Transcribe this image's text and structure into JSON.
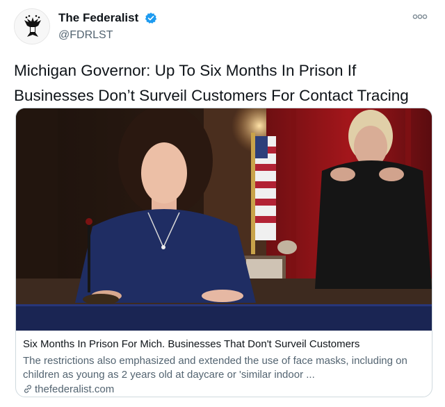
{
  "tweet": {
    "account": {
      "display_name": "The Federalist",
      "handle": "@FDRLST",
      "verified": true,
      "verified_color": "#1d9bf0"
    },
    "text": "Michigan Governor: Up To Six Months In Prison If Businesses Don’t Surveil Customers For Contact Tracing",
    "card": {
      "title": "Six Months In Prison For Mich. Businesses That Don't Surveil Customers",
      "description": "The restrictions also emphasized and extended the use of face masks, including on children as young as 2 years old at daycare or 'similar indoor ...",
      "domain": "thefederalist.com"
    }
  }
}
